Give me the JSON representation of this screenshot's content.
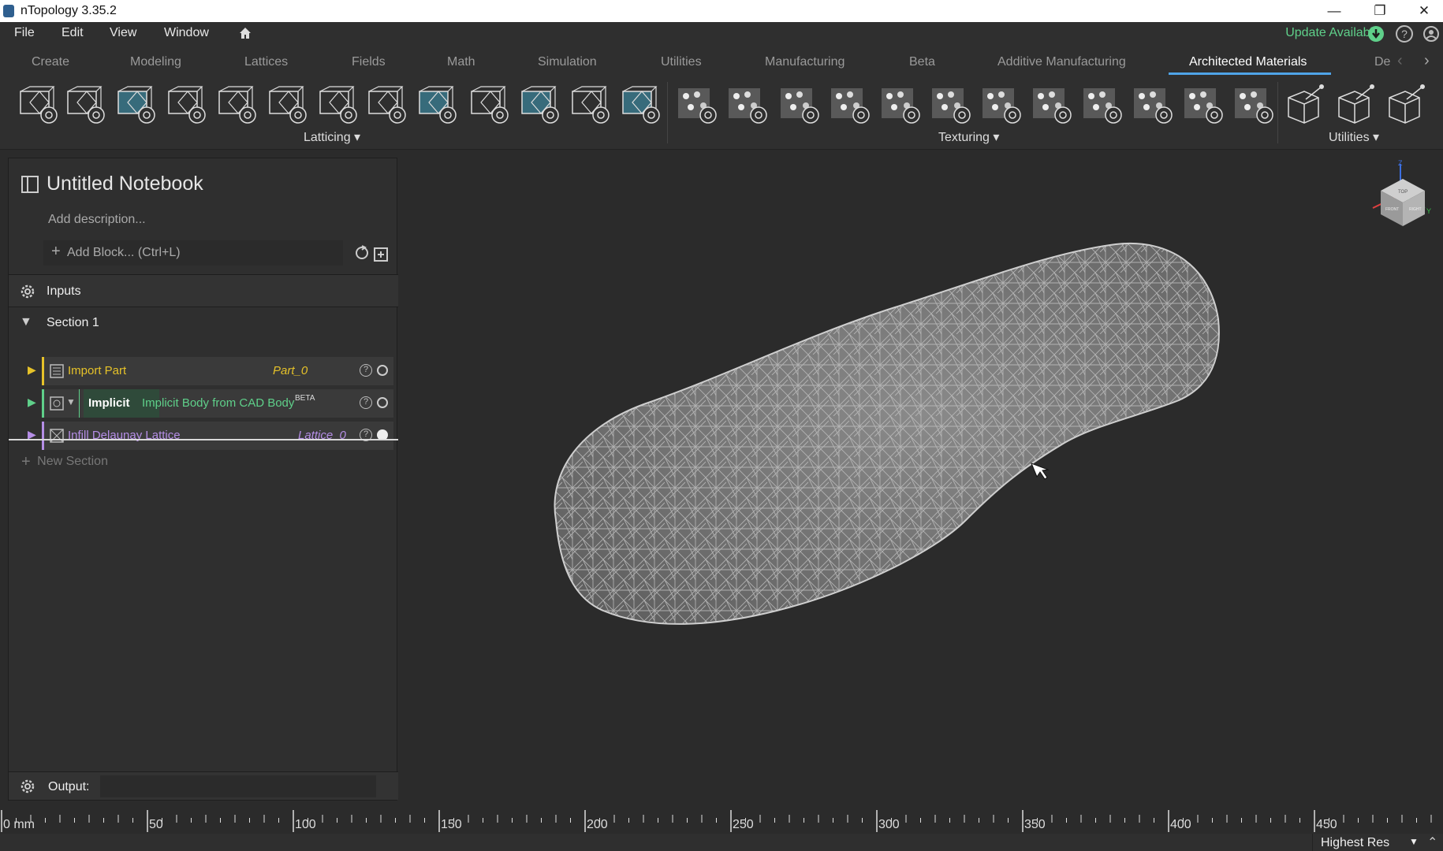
{
  "window": {
    "title": "nTopology 3.35.2",
    "minimize": "—",
    "restore": "❐",
    "close": "✕"
  },
  "menu": {
    "items": [
      "File",
      "Edit",
      "View",
      "Window"
    ],
    "update": "Update Available"
  },
  "tabs": [
    "Create",
    "Modeling",
    "Lattices",
    "Fields",
    "Math",
    "Simulation",
    "Utilities",
    "Manufacturing",
    "Beta",
    "Additive Manufacturing",
    "Architected Materials",
    "De"
  ],
  "ribbon": {
    "groups": [
      "Latticing",
      "Texturing",
      "Utilities"
    ]
  },
  "notebook": {
    "title": "Untitled Notebook",
    "description_placeholder": "Add description...",
    "add_block": "Add Block... (Ctrl+L)",
    "inputs": "Inputs",
    "section": "Section 1",
    "blocks": [
      {
        "name": "Import Part",
        "output": "Part_0"
      },
      {
        "tag": "Implicit",
        "name": "Implicit Body from CAD Body",
        "badge": "BETA"
      },
      {
        "name": "Infill Delaunay Lattice",
        "output": "Lattice_0"
      }
    ],
    "new_section": "New Section",
    "output_label": "Output:"
  },
  "viewcube": {
    "top": "TOP",
    "front": "FRONT",
    "right": "RIGHT",
    "axes": [
      "Z",
      "X",
      "Y"
    ]
  },
  "ruler": {
    "labels": [
      "0 mm",
      "50",
      "100",
      "150",
      "200",
      "250",
      "300",
      "350",
      "400",
      "450"
    ]
  },
  "status": {
    "resolution": "Highest Res"
  },
  "colors": {
    "accent": "#4fa4e8",
    "update": "#5fd08a",
    "block_name": "#e6c229",
    "implicit": "#5fd08a",
    "lattice": "#b58ee6"
  }
}
